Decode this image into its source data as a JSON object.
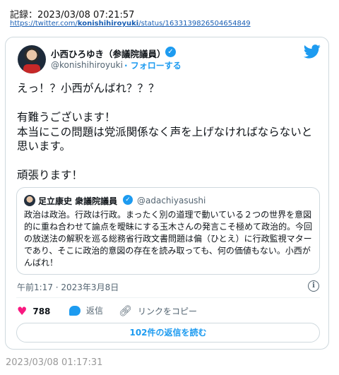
{
  "record": {
    "label": "記録：2023/03/08 07:21:57",
    "url_prefix": "https://twitter.com/",
    "url_user": "konishihiroyuki",
    "url_suffix": "/status/1633139826504654849"
  },
  "tweet": {
    "author_name": "小西ひろゆき（参議院議員）",
    "handle": "@konishihiroyuki",
    "follow_label": "· フォローする",
    "text": "えっ！？小西がんばれ？？？\n\n有難うございます！\n本当にこの問題は党派関係なく声を上げなければならないと思います。\n\n頑張ります！",
    "timestamp": "午前1:17 · 2023年3月8日",
    "like_count": "788",
    "reply_label": "返信",
    "copy_link_label": "リンクをコピー",
    "read_replies_label": "102件の返信を読む"
  },
  "quoted_tweet": {
    "author_name": "足立康史 衆議院議員",
    "handle": "@adachiyasushi",
    "text": "政治は政治。行政は行政。まったく別の道理で動いている２つの世界を意図的に重ね合わせて論点を曖昧にする玉木さんの発言こそ極めて政治的。今回の放送法の解釈を巡る総務省行政文書問題は偏（ひとえ）に行政監視マターであり、そこに政治的意図の存在を読み取っても、何の価値もない。小西がんばれ！"
  },
  "footer": {
    "timestamp": "2023/03/08 01:17:31"
  },
  "colors": {
    "accent": "#1d9bf0",
    "like": "#f91880",
    "secondary_text": "#536471",
    "border": "#cfd9de"
  },
  "icons": [
    "verified-badge-icon",
    "twitter-logo-icon",
    "heart-icon",
    "reply-icon",
    "link-icon",
    "info-icon"
  ]
}
